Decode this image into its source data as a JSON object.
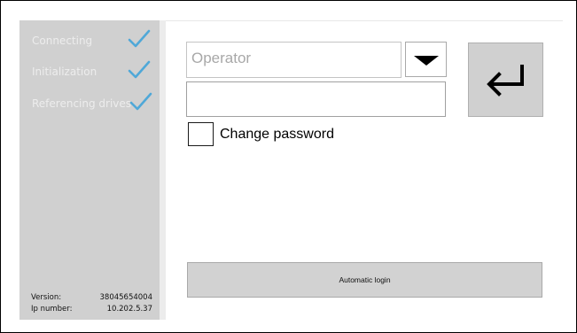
{
  "status_panel": {
    "steps": [
      {
        "label": "Connecting",
        "icon": "checkmark-icon"
      },
      {
        "label": "Initialization",
        "icon": "checkmark-icon"
      },
      {
        "label": "Referencing drives",
        "icon": "checkmark-icon"
      }
    ],
    "info": {
      "version_label": "Version:",
      "version_value": "38045654004",
      "ip_label": "Ip number:",
      "ip_value": "10.202.5.37"
    }
  },
  "login": {
    "user_placeholder": "Operator",
    "dropdown_icon": "triangle-down-icon",
    "password_value": "",
    "change_password_label": "Change password",
    "change_password_checked": false,
    "enter_icon": "enter-arrow-icon",
    "auto_login_label": "Automatic login"
  },
  "colors": {
    "panel_bg": "#d0d0d0",
    "checkmark": "#4fa8d8",
    "step_text": "#ededed",
    "button_bg": "#d2d2d2"
  }
}
